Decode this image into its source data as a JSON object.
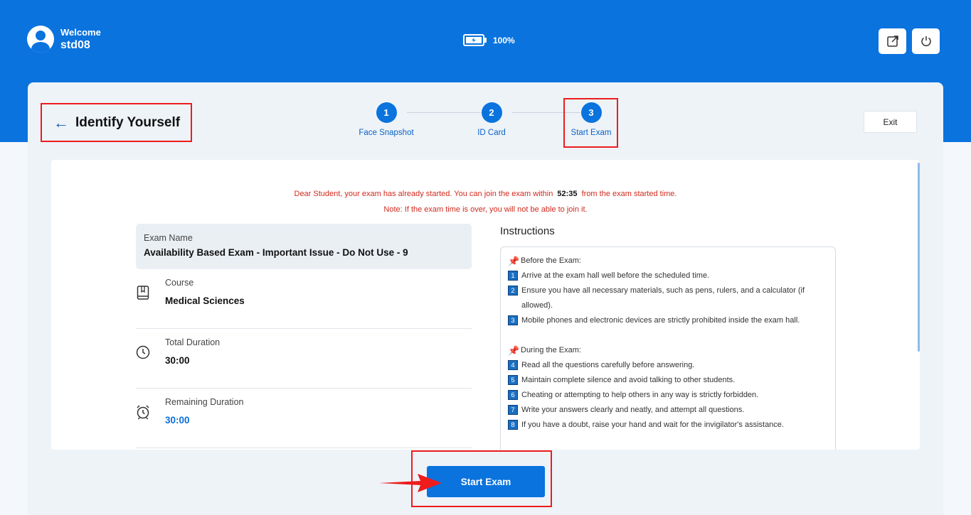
{
  "header": {
    "welcome_label": "Welcome",
    "username": "std08",
    "battery": "100%",
    "icons": [
      "user-avatar-icon",
      "battery-icon",
      "external-link-icon",
      "power-icon"
    ],
    "accent_color": "#0a73de"
  },
  "page": {
    "title": "Identify Yourself",
    "exit_label": "Exit"
  },
  "steps": [
    {
      "number": "1",
      "label": "Face Snapshot"
    },
    {
      "number": "2",
      "label": "ID Card"
    },
    {
      "number": "3",
      "label": "Start Exam"
    }
  ],
  "notice": {
    "prefix": "Dear Student, your exam has already started. You can join the exam within",
    "time": "52:35",
    "suffix": "from the exam started time.",
    "note": "Note: If the exam time is over, you will not be able to join it."
  },
  "exam": {
    "name_label": "Exam Name",
    "name_value": "Availability Based Exam - Important Issue - Do Not Use - 9",
    "course_label": "Course",
    "course_value": "Medical Sciences",
    "total_label": "Total Duration",
    "total_value": "30:00",
    "remaining_label": "Remaining Duration",
    "remaining_value": "30:00"
  },
  "instructions": {
    "heading": "Instructions",
    "before_title": "Before the Exam:",
    "before_items": [
      {
        "num": "1",
        "text": "Arrive at the exam hall well before the scheduled time."
      },
      {
        "num": "2",
        "text": "Ensure you have all necessary materials, such as pens, rulers, and a calculator (if allowed)."
      },
      {
        "num": "3",
        "text": "Mobile phones and electronic devices are strictly prohibited inside the exam hall."
      }
    ],
    "during_title": "During the Exam:",
    "during_items": [
      {
        "num": "4",
        "text": "Read all the questions carefully before answering."
      },
      {
        "num": "5",
        "text": "Maintain complete silence and avoid talking to other students."
      },
      {
        "num": "6",
        "text": "Cheating or attempting to help others in any way is strictly forbidden."
      },
      {
        "num": "7",
        "text": "Write your answers clearly and neatly, and attempt all questions."
      },
      {
        "num": "8",
        "text": "If you have a doubt, raise your hand and wait for the invigilator's assistance."
      }
    ]
  },
  "actions": {
    "start_label": "Start Exam"
  }
}
